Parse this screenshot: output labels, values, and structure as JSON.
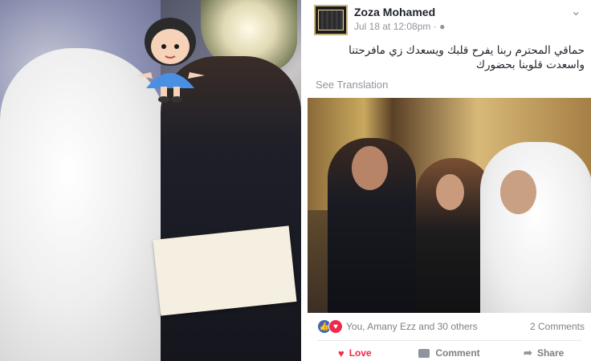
{
  "post": {
    "author": "Zoza Mohamed",
    "timestamp": "Jul 18 at 12:08pm",
    "privacy_icon": "globe-dot",
    "text": "حماقي المحترم ربنا يفرح قلبك ويسعدك زي مافرحتنا واسعدت قلوبنا بحضورك",
    "see_translation": "See Translation",
    "reactions_summary": "You, Amany Ezz and 30 others",
    "comments_count": "2 Comments"
  },
  "actions": {
    "love_label": "Love",
    "comment_label": "Comment",
    "share_label": "Share"
  },
  "colors": {
    "love": "#f0284a",
    "like": "#4267b2",
    "meta_gray": "#90949c",
    "text": "#1d2129"
  },
  "icons": {
    "chevron": "chevron-down-icon",
    "like": "thumbs-up-icon",
    "love": "heart-icon",
    "comment": "comment-icon",
    "share": "share-arrow-icon"
  }
}
